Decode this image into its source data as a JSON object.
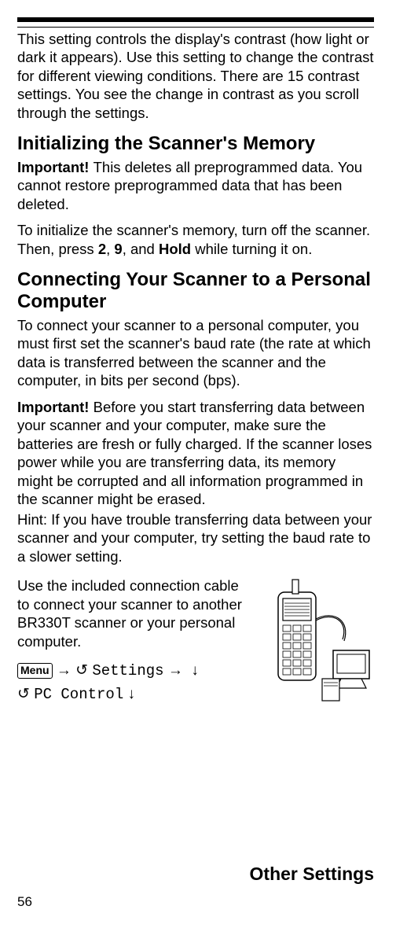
{
  "top_para": "This setting controls the display's contrast (how light or dark it appears). Use this setting to change the contrast for different viewing conditions. There are 15 contrast settings. You see the change in contrast as you scroll through the settings.",
  "h1": "Initializing the Scanner's Memory",
  "imp1_prefix": "Important! ",
  "imp1_body": "This deletes all preprogrammed data. You cannot restore preprogrammed data that has been deleted.",
  "init_a": "To initialize the scanner's memory, turn off the scanner. Then, press ",
  "key2": "2",
  "init_b": ", ",
  "key9": "9",
  "init_c": ", and ",
  "hold": "Hold",
  "init_d": " while turning it on.",
  "h2": "Connecting Your Scanner to a Personal Computer",
  "conn1": "To connect your scanner to a personal computer, you must first set the scanner's baud rate (the rate at which data is transferred between the scanner and the computer, in bits per second (bps).",
  "imp2_prefix": "Important! ",
  "imp2_body": "Before you start transferring data between your scanner and your computer, make sure the batteries are fresh or fully charged. If the scanner loses power while you are transferring data, its memory might be corrupted and all information programmed in the scanner might be erased.",
  "hint": "Hint: If you have trouble transferring data between your scanner and your computer, try setting the baud rate to a slower setting.",
  "use_cable": "Use the included connection cable to connect your scanner to another BR330T scanner or your personal computer.",
  "menu_label": "Menu",
  "settings": "Settings",
  "pc_control": "PC Control",
  "footer": "Other Settings",
  "page": "56"
}
